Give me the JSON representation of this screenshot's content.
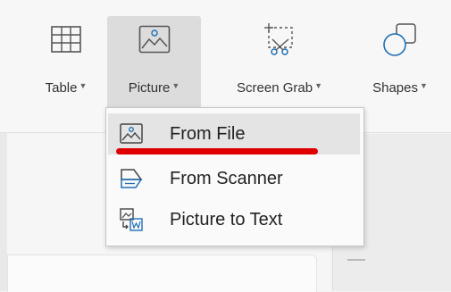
{
  "ribbon": {
    "buttons": [
      {
        "label": "Table",
        "icon": "table-icon"
      },
      {
        "label": "Picture",
        "icon": "picture-icon"
      },
      {
        "label": "Screen Grab",
        "icon": "screen-grab-icon"
      },
      {
        "label": "Shapes",
        "icon": "shapes-icon"
      }
    ],
    "dropdown_arrow": "▼"
  },
  "menu": {
    "items": [
      {
        "label": "From File",
        "icon": "picture-file-icon"
      },
      {
        "label": "From Scanner",
        "icon": "scanner-icon"
      },
      {
        "label": "Picture to Text",
        "icon": "picture-to-text-icon"
      }
    ]
  },
  "colors": {
    "accent": "#1f6fb5",
    "annotation": "#e00000",
    "icon_stroke": "#555555"
  }
}
